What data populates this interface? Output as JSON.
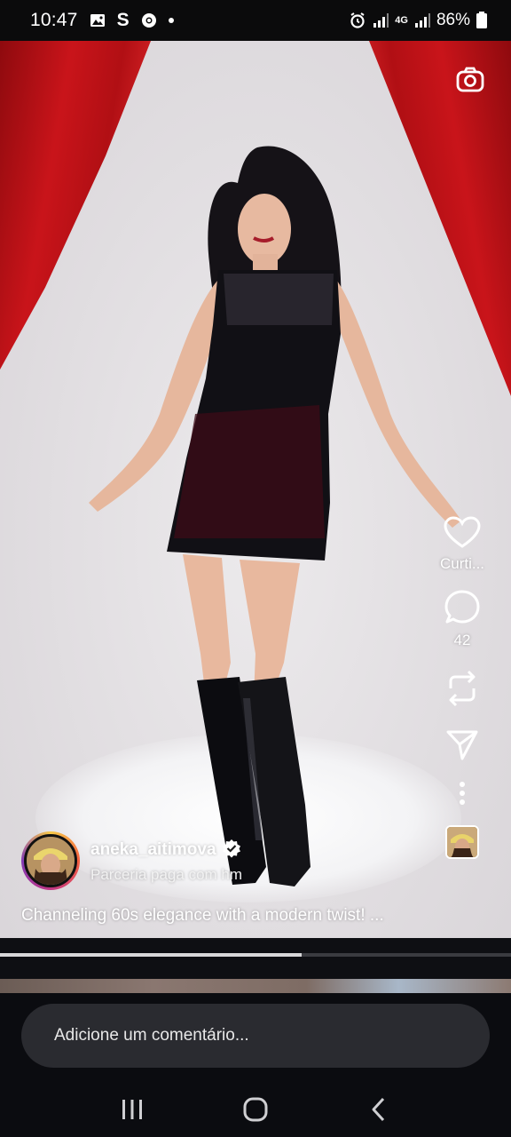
{
  "status_bar": {
    "time": "10:47",
    "carrier_glyph": "S",
    "network": "4G",
    "battery": "86%",
    "icons": [
      "image-icon",
      "chrome-icon",
      "notification-dot",
      "alarm-icon",
      "signal-icon",
      "battery-icon"
    ]
  },
  "video": {
    "camera_icon": "camera-icon",
    "progress_fraction": 0.59
  },
  "actions": {
    "like_label": "Curti...",
    "comment_count": "42",
    "icons": [
      "heart-icon",
      "comment-icon",
      "repost-icon",
      "send-icon",
      "more-icon"
    ]
  },
  "author": {
    "username": "aneka_aitimova",
    "verified": true,
    "paid_partnership": "Parceria paga com hm"
  },
  "caption": "Channeling 60s elegance with a modern twist! ...",
  "comment": {
    "placeholder": "Adicione um comentário..."
  },
  "nav": {
    "icons": [
      "recents-icon",
      "home-icon",
      "back-icon"
    ]
  },
  "colors": {
    "accent_gradient": [
      "#f7c948",
      "#f56040",
      "#c13584",
      "#833ab4"
    ],
    "curtain": "#c9141a",
    "bar_bg": "#0b0c10"
  }
}
